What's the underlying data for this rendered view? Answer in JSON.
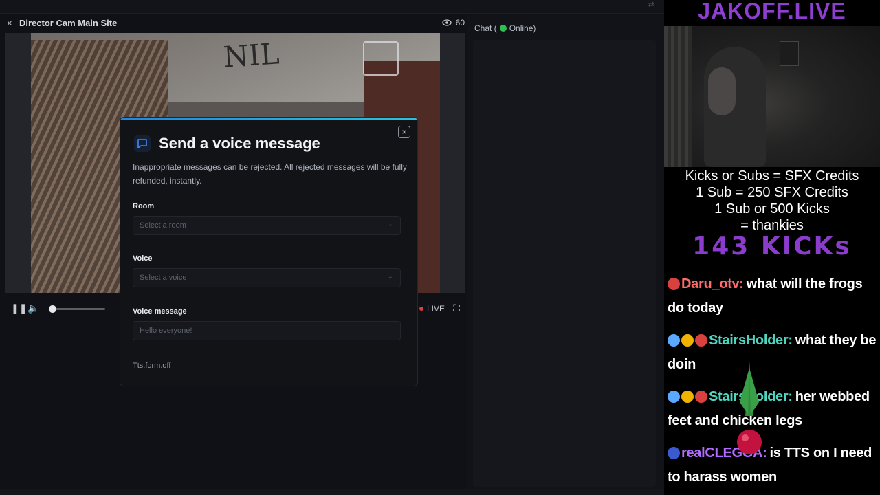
{
  "app": {
    "cam_title": "Director Cam Main Site",
    "close_symbol": "×",
    "viewer_count": "60",
    "live_label": "LIVE"
  },
  "chat": {
    "label": "Chat (",
    "status": "Online)"
  },
  "modal": {
    "title": "Send a voice message",
    "description": "Inappropriate messages can be rejected. All rejected messages will be fully refunded, instantly.",
    "room_label": "Room",
    "room_placeholder": "Select a room",
    "voice_label": "Voice",
    "voice_placeholder": "Select a voice",
    "message_label": "Voice message",
    "message_placeholder": "Hello everyone!",
    "footer": "Tts.form.off"
  },
  "overlay": {
    "site": "JAKOFF.LIVE",
    "credits": [
      "Kicks or Subs = SFX Credits",
      "1 Sub = 250 SFX Credits",
      "1 Sub or 500 Kicks",
      "= thankies"
    ],
    "kicks": "143 KICKs",
    "messages": [
      {
        "user": "Daru_otv:",
        "text": "what will the frogs do today",
        "color": "#ff6b6b",
        "badges": [
          "#d94040"
        ]
      },
      {
        "user": "StairsHolder:",
        "text": "what they be doin",
        "color": "#4ed6c0",
        "badges": [
          "#5aa8ff",
          "#f0b400",
          "#d94040"
        ]
      },
      {
        "user": "StairsHolder:",
        "text": "her webbed feet and chicken legs",
        "color": "#4ed6c0",
        "badges": [
          "#5aa8ff",
          "#f0b400",
          "#d94040"
        ]
      },
      {
        "user": "realCLEGGA:",
        "text": "is TTS on I need to harass women",
        "color": "#b16cff",
        "badges": [
          "#3a5bd0"
        ]
      }
    ]
  }
}
